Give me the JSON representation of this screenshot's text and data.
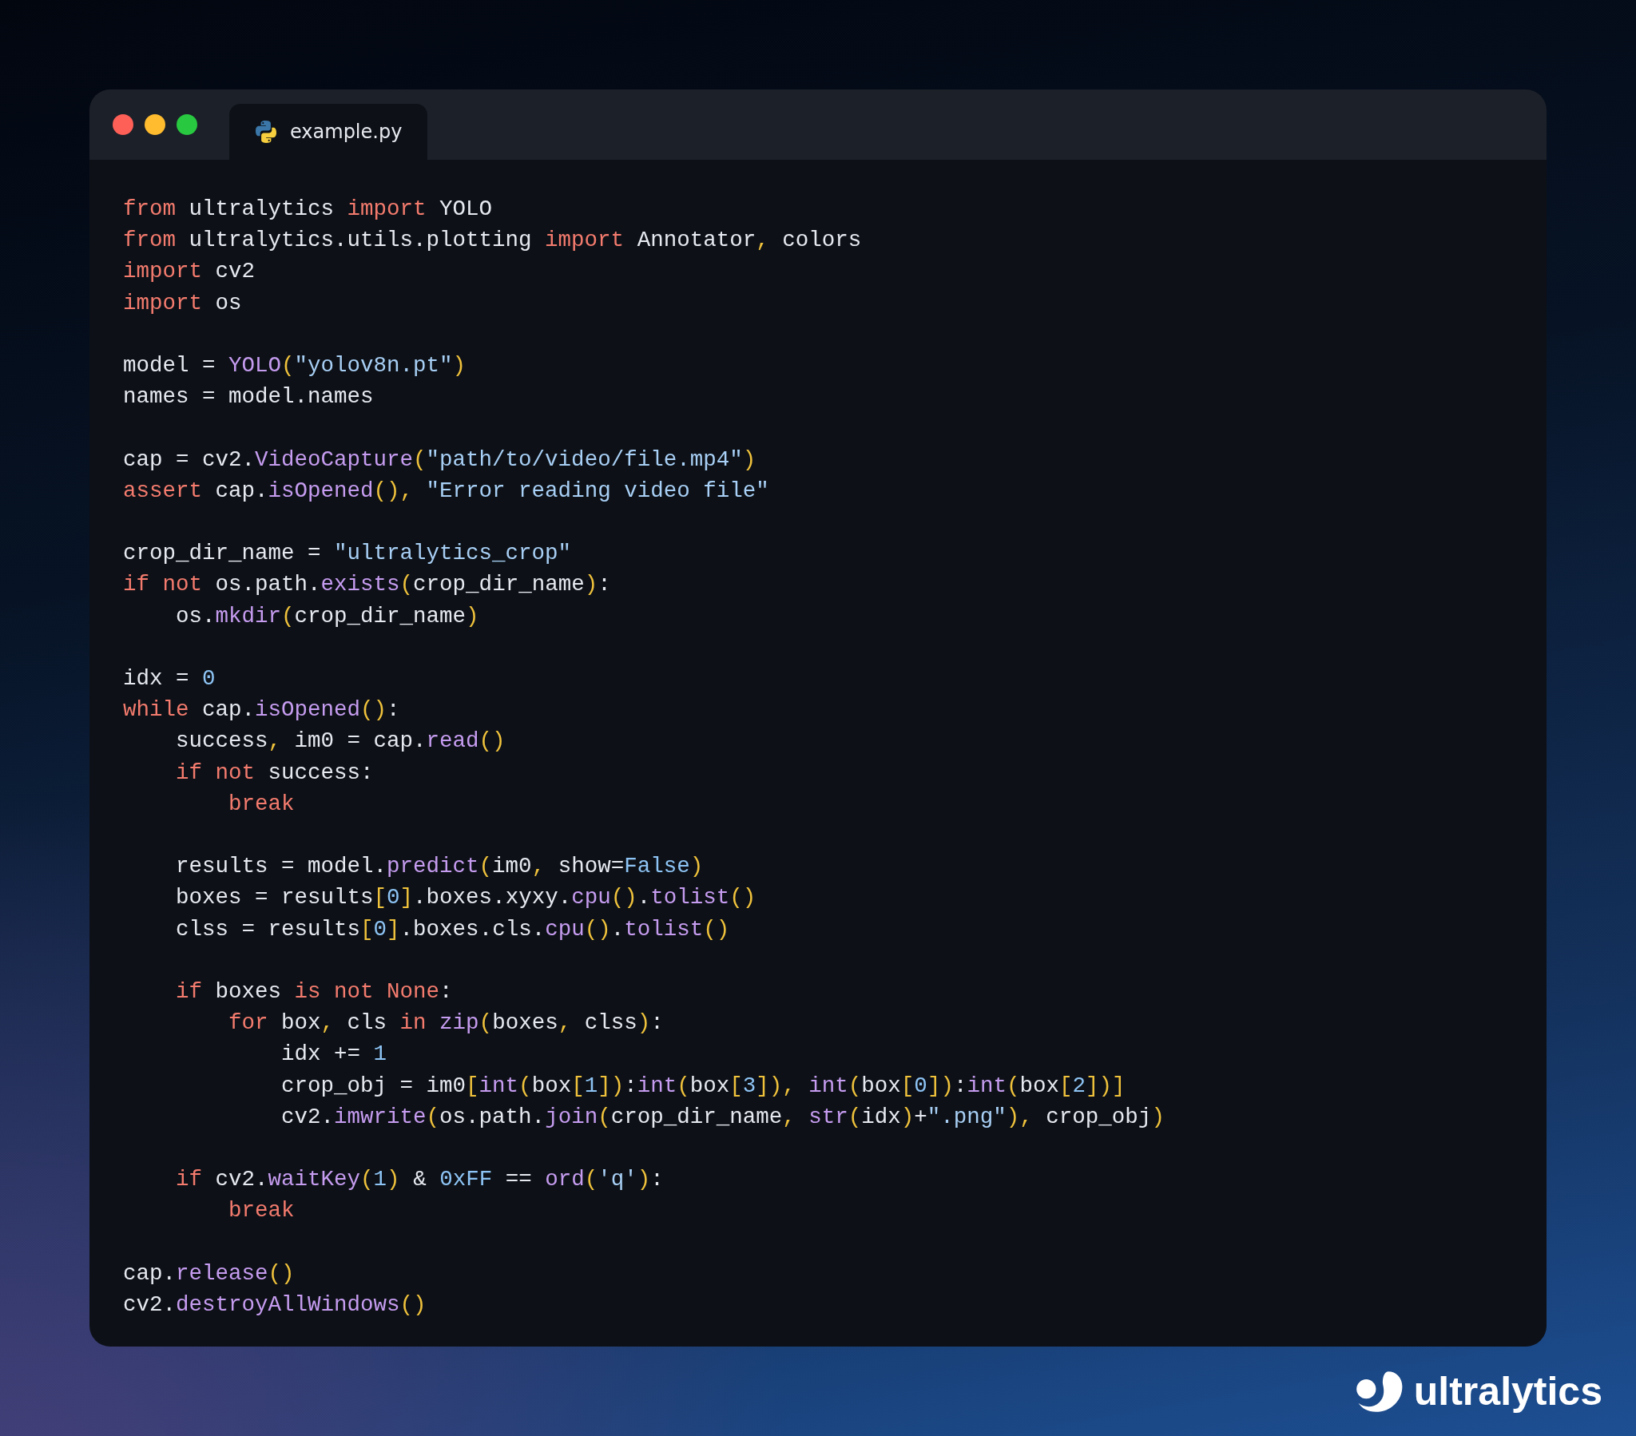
{
  "window": {
    "tab": {
      "label": "example.py",
      "selected": true
    }
  },
  "code": {
    "blocks": [
      [
        [
          {
            "kind": "keyword",
            "text": "from"
          },
          {
            "kind": "plain",
            "text": " ultralytics "
          },
          {
            "kind": "keyword",
            "text": "import"
          },
          {
            "kind": "plain",
            "text": " YOLO"
          }
        ],
        [
          {
            "kind": "keyword",
            "text": "from"
          },
          {
            "kind": "plain",
            "text": " ultralytics.utils.plotting "
          },
          {
            "kind": "keyword",
            "text": "import"
          },
          {
            "kind": "plain",
            "text": " Annotator"
          },
          {
            "kind": "punct",
            "text": ","
          },
          {
            "kind": "plain",
            "text": " colors"
          }
        ],
        [
          {
            "kind": "keyword",
            "text": "import"
          },
          {
            "kind": "plain",
            "text": " cv2"
          }
        ],
        [
          {
            "kind": "keyword",
            "text": "import"
          },
          {
            "kind": "plain",
            "text": " os"
          }
        ]
      ],
      [
        [
          {
            "kind": "plain",
            "text": "model = "
          },
          {
            "kind": "function",
            "text": "YOLO"
          },
          {
            "kind": "punct",
            "text": "("
          },
          {
            "kind": "string",
            "text": "\"yolov8n.pt\""
          },
          {
            "kind": "punct",
            "text": ")"
          }
        ],
        [
          {
            "kind": "plain",
            "text": "names = model.names"
          }
        ]
      ],
      [
        [
          {
            "kind": "plain",
            "text": "cap = cv2."
          },
          {
            "kind": "function",
            "text": "VideoCapture"
          },
          {
            "kind": "punct",
            "text": "("
          },
          {
            "kind": "string",
            "text": "\"path/to/video/file.mp4\""
          },
          {
            "kind": "punct",
            "text": ")"
          }
        ],
        [
          {
            "kind": "keyword",
            "text": "assert"
          },
          {
            "kind": "plain",
            "text": " cap."
          },
          {
            "kind": "function",
            "text": "isOpened"
          },
          {
            "kind": "punct",
            "text": "(),"
          },
          {
            "kind": "string",
            "text": " \"Error reading video file\""
          }
        ]
      ],
      [
        [
          {
            "kind": "plain",
            "text": "crop_dir_name = "
          },
          {
            "kind": "string",
            "text": "\"ultralytics_crop\""
          }
        ],
        [
          {
            "kind": "keyword",
            "text": "if not"
          },
          {
            "kind": "plain",
            "text": " os.path."
          },
          {
            "kind": "function",
            "text": "exists"
          },
          {
            "kind": "punct",
            "text": "("
          },
          {
            "kind": "plain",
            "text": "crop_dir_name"
          },
          {
            "kind": "punct",
            "text": ")"
          },
          {
            "kind": "plain",
            "text": ":"
          }
        ],
        [
          {
            "kind": "plain",
            "text": "    os."
          },
          {
            "kind": "function",
            "text": "mkdir"
          },
          {
            "kind": "punct",
            "text": "("
          },
          {
            "kind": "plain",
            "text": "crop_dir_name"
          },
          {
            "kind": "punct",
            "text": ")"
          }
        ]
      ],
      [
        [
          {
            "kind": "plain",
            "text": "idx = "
          },
          {
            "kind": "number",
            "text": "0"
          }
        ],
        [
          {
            "kind": "keyword",
            "text": "while"
          },
          {
            "kind": "plain",
            "text": " cap."
          },
          {
            "kind": "function",
            "text": "isOpened"
          },
          {
            "kind": "punct",
            "text": "()"
          },
          {
            "kind": "plain",
            "text": ":"
          }
        ],
        [
          {
            "kind": "plain",
            "text": "    success"
          },
          {
            "kind": "punct",
            "text": ","
          },
          {
            "kind": "plain",
            "text": " im0 = cap."
          },
          {
            "kind": "function",
            "text": "read"
          },
          {
            "kind": "punct",
            "text": "()"
          }
        ],
        [
          {
            "kind": "keyword",
            "text": "    if not"
          },
          {
            "kind": "plain",
            "text": " success:"
          }
        ],
        [
          {
            "kind": "keyword",
            "text": "        break"
          }
        ]
      ],
      [
        [
          {
            "kind": "plain",
            "text": "    results = model."
          },
          {
            "kind": "function",
            "text": "predict"
          },
          {
            "kind": "punct",
            "text": "("
          },
          {
            "kind": "plain",
            "text": "im0"
          },
          {
            "kind": "punct",
            "text": ","
          },
          {
            "kind": "plain",
            "text": " show="
          },
          {
            "kind": "number",
            "text": "False"
          },
          {
            "kind": "punct",
            "text": ")"
          }
        ],
        [
          {
            "kind": "plain",
            "text": "    boxes = results"
          },
          {
            "kind": "punct",
            "text": "["
          },
          {
            "kind": "number",
            "text": "0"
          },
          {
            "kind": "punct",
            "text": "]"
          },
          {
            "kind": "plain",
            "text": ".boxes.xyxy."
          },
          {
            "kind": "function",
            "text": "cpu"
          },
          {
            "kind": "punct",
            "text": "()"
          },
          {
            "kind": "plain",
            "text": "."
          },
          {
            "kind": "function",
            "text": "tolist"
          },
          {
            "kind": "punct",
            "text": "()"
          }
        ],
        [
          {
            "kind": "plain",
            "text": "    clss = results"
          },
          {
            "kind": "punct",
            "text": "["
          },
          {
            "kind": "number",
            "text": "0"
          },
          {
            "kind": "punct",
            "text": "]"
          },
          {
            "kind": "plain",
            "text": ".boxes.cls."
          },
          {
            "kind": "function",
            "text": "cpu"
          },
          {
            "kind": "punct",
            "text": "()"
          },
          {
            "kind": "plain",
            "text": "."
          },
          {
            "kind": "function",
            "text": "tolist"
          },
          {
            "kind": "punct",
            "text": "()"
          }
        ]
      ],
      [
        [
          {
            "kind": "keyword",
            "text": "    if"
          },
          {
            "kind": "plain",
            "text": " boxes "
          },
          {
            "kind": "keyword",
            "text": "is not None"
          },
          {
            "kind": "plain",
            "text": ":"
          }
        ],
        [
          {
            "kind": "keyword",
            "text": "        for"
          },
          {
            "kind": "plain",
            "text": " box"
          },
          {
            "kind": "punct",
            "text": ","
          },
          {
            "kind": "plain",
            "text": " cls "
          },
          {
            "kind": "keyword",
            "text": "in"
          },
          {
            "kind": "function",
            "text": " zip"
          },
          {
            "kind": "punct",
            "text": "("
          },
          {
            "kind": "plain",
            "text": "boxes"
          },
          {
            "kind": "punct",
            "text": ","
          },
          {
            "kind": "plain",
            "text": " clss"
          },
          {
            "kind": "punct",
            "text": ")"
          },
          {
            "kind": "plain",
            "text": ":"
          }
        ],
        [
          {
            "kind": "plain",
            "text": "            idx += "
          },
          {
            "kind": "number",
            "text": "1"
          }
        ],
        [
          {
            "kind": "plain",
            "text": "            crop_obj = im0"
          },
          {
            "kind": "punct",
            "text": "["
          },
          {
            "kind": "function",
            "text": "int"
          },
          {
            "kind": "punct",
            "text": "("
          },
          {
            "kind": "plain",
            "text": "box"
          },
          {
            "kind": "punct",
            "text": "["
          },
          {
            "kind": "number",
            "text": "1"
          },
          {
            "kind": "punct",
            "text": "])"
          },
          {
            "kind": "plain",
            "text": ":"
          },
          {
            "kind": "function",
            "text": "int"
          },
          {
            "kind": "punct",
            "text": "("
          },
          {
            "kind": "plain",
            "text": "box"
          },
          {
            "kind": "punct",
            "text": "["
          },
          {
            "kind": "number",
            "text": "3"
          },
          {
            "kind": "punct",
            "text": "]),"
          },
          {
            "kind": "function",
            "text": " int"
          },
          {
            "kind": "punct",
            "text": "("
          },
          {
            "kind": "plain",
            "text": "box"
          },
          {
            "kind": "punct",
            "text": "["
          },
          {
            "kind": "number",
            "text": "0"
          },
          {
            "kind": "punct",
            "text": "])"
          },
          {
            "kind": "plain",
            "text": ":"
          },
          {
            "kind": "function",
            "text": "int"
          },
          {
            "kind": "punct",
            "text": "("
          },
          {
            "kind": "plain",
            "text": "box"
          },
          {
            "kind": "punct",
            "text": "["
          },
          {
            "kind": "number",
            "text": "2"
          },
          {
            "kind": "punct",
            "text": "])]"
          }
        ],
        [
          {
            "kind": "plain",
            "text": "            cv2."
          },
          {
            "kind": "function",
            "text": "imwrite"
          },
          {
            "kind": "punct",
            "text": "("
          },
          {
            "kind": "plain",
            "text": "os.path."
          },
          {
            "kind": "function",
            "text": "join"
          },
          {
            "kind": "punct",
            "text": "("
          },
          {
            "kind": "plain",
            "text": "crop_dir_name"
          },
          {
            "kind": "punct",
            "text": ","
          },
          {
            "kind": "function",
            "text": " str"
          },
          {
            "kind": "punct",
            "text": "("
          },
          {
            "kind": "plain",
            "text": "idx"
          },
          {
            "kind": "punct",
            "text": ")"
          },
          {
            "kind": "plain",
            "text": "+"
          },
          {
            "kind": "string",
            "text": "\".png\""
          },
          {
            "kind": "punct",
            "text": "),"
          },
          {
            "kind": "plain",
            "text": " crop_obj"
          },
          {
            "kind": "punct",
            "text": ")"
          }
        ]
      ],
      [
        [
          {
            "kind": "keyword",
            "text": "    if"
          },
          {
            "kind": "plain",
            "text": " cv2."
          },
          {
            "kind": "function",
            "text": "waitKey"
          },
          {
            "kind": "punct",
            "text": "("
          },
          {
            "kind": "number",
            "text": "1"
          },
          {
            "kind": "punct",
            "text": ")"
          },
          {
            "kind": "plain",
            "text": " & "
          },
          {
            "kind": "number",
            "text": "0xFF"
          },
          {
            "kind": "plain",
            "text": " == "
          },
          {
            "kind": "function",
            "text": "ord"
          },
          {
            "kind": "punct",
            "text": "("
          },
          {
            "kind": "string",
            "text": "'q'"
          },
          {
            "kind": "punct",
            "text": ")"
          },
          {
            "kind": "plain",
            "text": ":"
          }
        ],
        [
          {
            "kind": "keyword",
            "text": "        break"
          }
        ]
      ],
      [
        [
          {
            "kind": "plain",
            "text": "cap."
          },
          {
            "kind": "function",
            "text": "release"
          },
          {
            "kind": "punct",
            "text": "()"
          }
        ],
        [
          {
            "kind": "plain",
            "text": "cv2."
          },
          {
            "kind": "function",
            "text": "destroyAllWindows"
          },
          {
            "kind": "punct",
            "text": "()"
          }
        ]
      ]
    ]
  },
  "logo": {
    "text": "ultralytics"
  }
}
